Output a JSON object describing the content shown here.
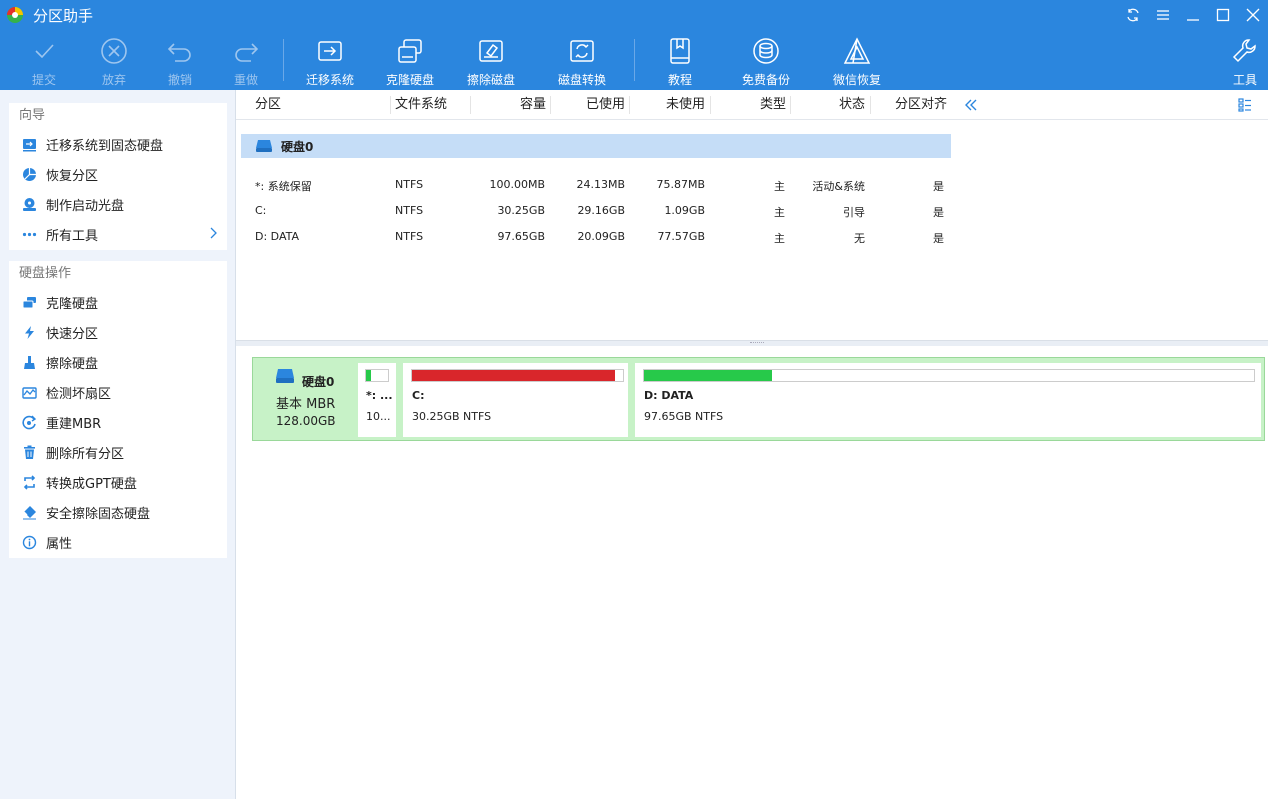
{
  "app": {
    "title": "分区助手"
  },
  "colors": {
    "accent": "#2b86de",
    "used_red": "#d9262b",
    "used_green": "#27c94a",
    "disk_map_bg": "#c7f2c7",
    "selected_row": "#c5ddf7"
  },
  "toolbar": {
    "submit": "提交",
    "discard": "放弃",
    "undo": "撤销",
    "redo": "重做",
    "migrate_os": "迁移系统",
    "clone_disk": "克隆硬盘",
    "wipe_disk": "擦除磁盘",
    "convert_disk": "磁盘转换",
    "tutorial": "教程",
    "free_backup": "免费备份",
    "wechat_recovery": "微信恢复",
    "tools": "工具"
  },
  "sidebar": {
    "wizard": {
      "title": "向导",
      "items": [
        {
          "label": "迁移系统到固态硬盘",
          "icon": "migrate-icon"
        },
        {
          "label": "恢复分区",
          "icon": "recover-partition-icon"
        },
        {
          "label": "制作启动光盘",
          "icon": "bootable-disc-icon"
        },
        {
          "label": "所有工具",
          "icon": "more-icon"
        }
      ]
    },
    "disk_ops": {
      "title": "硬盘操作",
      "items": [
        {
          "label": "克隆硬盘",
          "icon": "clone-disk-icon"
        },
        {
          "label": "快速分区",
          "icon": "lightning-icon"
        },
        {
          "label": "擦除硬盘",
          "icon": "wipe-icon"
        },
        {
          "label": "检测坏扇区",
          "icon": "bad-sector-icon"
        },
        {
          "label": "重建MBR",
          "icon": "rebuild-mbr-icon"
        },
        {
          "label": "删除所有分区",
          "icon": "trash-icon"
        },
        {
          "label": "转换成GPT硬盘",
          "icon": "convert-icon"
        },
        {
          "label": "安全擦除固态硬盘",
          "icon": "eraser-icon"
        },
        {
          "label": "属性",
          "icon": "info-icon"
        }
      ]
    }
  },
  "table": {
    "columns": [
      "分区",
      "文件系统",
      "容量",
      "已使用",
      "未使用",
      "类型",
      "状态",
      "分区对齐"
    ],
    "disk_name": "硬盘0",
    "rows": [
      {
        "partition": "*: 系统保留",
        "fs": "NTFS",
        "capacity": "100.00MB",
        "used": "24.13MB",
        "unused": "75.87MB",
        "type": "主",
        "status": "活动&系统",
        "aligned": "是"
      },
      {
        "partition": "C:",
        "fs": "NTFS",
        "capacity": "30.25GB",
        "used": "29.16GB",
        "unused": "1.09GB",
        "type": "主",
        "status": "引导",
        "aligned": "是"
      },
      {
        "partition": "D: DATA",
        "fs": "NTFS",
        "capacity": "97.65GB",
        "used": "20.09GB",
        "unused": "77.57GB",
        "type": "主",
        "status": "无",
        "aligned": "是"
      }
    ]
  },
  "diskmap": {
    "name": "硬盘0",
    "type": "基本 MBR",
    "size": "128.00GB",
    "partitions": [
      {
        "name": "*: ...",
        "info": "10...",
        "used_fraction": 0.24
      },
      {
        "name": "C:",
        "info": "30.25GB NTFS",
        "used_fraction": 0.96
      },
      {
        "name": "D: DATA",
        "info": "97.65GB NTFS",
        "used_fraction": 0.21
      }
    ]
  }
}
